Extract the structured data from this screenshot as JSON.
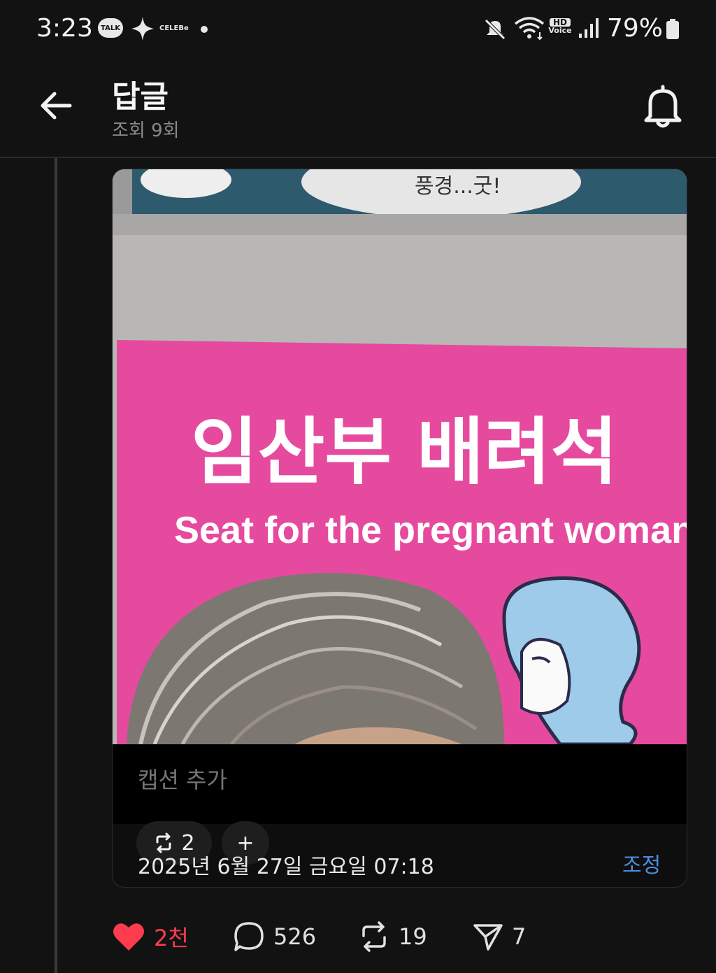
{
  "status_bar": {
    "time": "3:23",
    "talk_badge": "TALK",
    "celebe_label": "CELEBe",
    "hd_label": "HD",
    "voice_label": "Voice",
    "battery": "79%",
    "icons": [
      "talk-icon",
      "sparkle-icon",
      "mute-icon",
      "wifi-icon",
      "hd-voice-icon",
      "signal-icon",
      "battery-icon"
    ]
  },
  "header": {
    "title": "답글",
    "subtitle": "조회 9회"
  },
  "media": {
    "sign_speech": "풍경...굿!",
    "sign_korean": "임산부 배려석",
    "sign_english": "Seat for the pregnant woman",
    "colors": {
      "sign_pink": "#e64a9e",
      "wall": "#b9b7b6",
      "poster": "#2e5a6e",
      "figure_blue": "#9ecbe9"
    }
  },
  "card": {
    "caption_placeholder": "캡션 추가",
    "repost_count": "2",
    "add_label": "+",
    "date": "2025년 6월 27일 금요일 07:18",
    "edit_label": "조정"
  },
  "actions": {
    "likes": "2천",
    "replies": "526",
    "reposts": "19",
    "shares": "7",
    "like_color": "#ff3b4f"
  }
}
